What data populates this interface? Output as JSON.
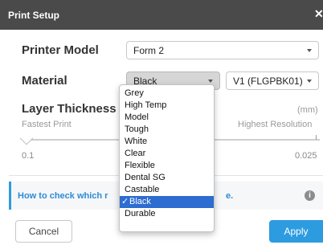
{
  "window": {
    "title": "Print Setup",
    "close_glyph": "✕"
  },
  "printer_model": {
    "label": "Printer Model",
    "value": "Form 2"
  },
  "material": {
    "label": "Material",
    "value": "Black",
    "version_value": "V1 (FLGPBK01)",
    "options": [
      "Grey",
      "High Temp",
      "Model",
      "Tough",
      "White",
      "Clear",
      "Flexible",
      "Dental SG",
      "Castable",
      "Black",
      "Durable"
    ],
    "selected_option": "Black"
  },
  "layer_thickness": {
    "label": "Layer Thickness",
    "unit": "(mm)",
    "left_caption": "Fastest Print",
    "right_caption": "Highest Resolution",
    "min_value": "0.1",
    "max_value": "0.025"
  },
  "info": {
    "link_text": "How to check which r",
    "link_tail": "e.",
    "icon": "info-icon"
  },
  "buttons": {
    "cancel": "Cancel",
    "apply": "Apply"
  },
  "colors": {
    "titlebar": "#4a4a4a",
    "accent": "#2d9be0",
    "selection": "#2d6cd0"
  }
}
